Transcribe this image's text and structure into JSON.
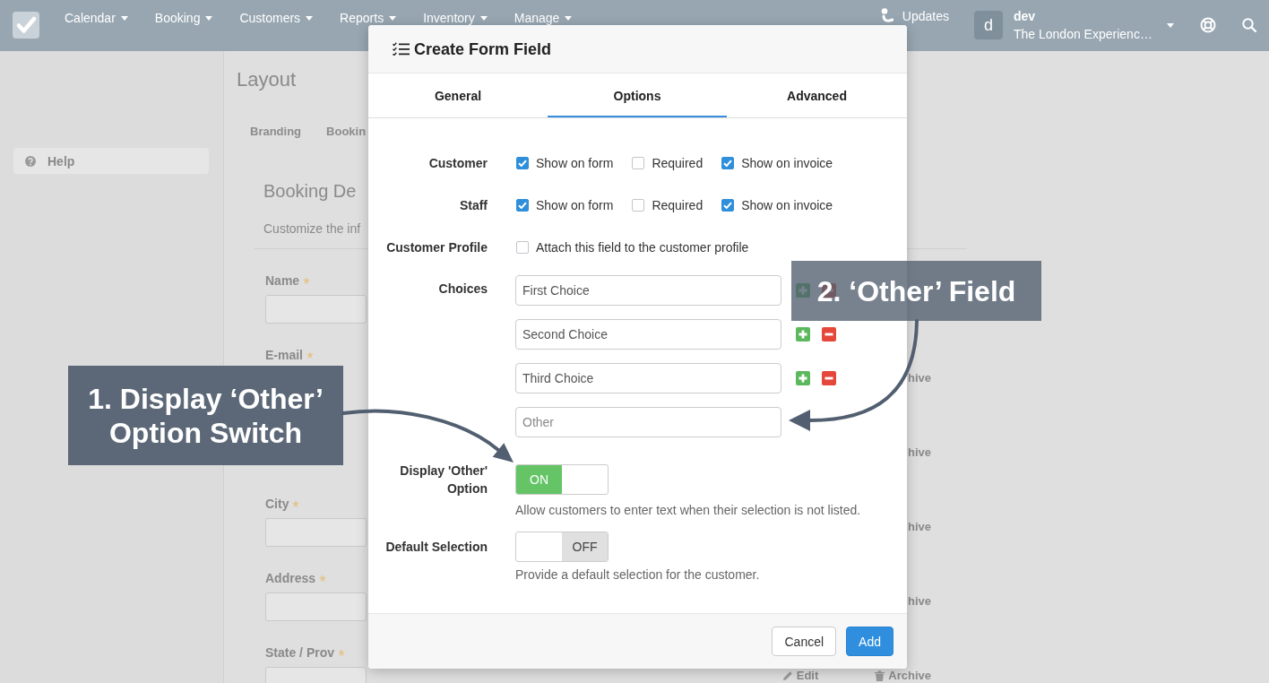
{
  "top_nav": {
    "menus": [
      {
        "label": "Calendar"
      },
      {
        "label": "Booking"
      },
      {
        "label": "Customers"
      },
      {
        "label": "Reports"
      },
      {
        "label": "Inventory"
      },
      {
        "label": "Manage"
      }
    ],
    "updates": "Updates",
    "account": {
      "avatar": "d",
      "name": "dev",
      "organization": "The London Experienc…"
    }
  },
  "sidebar": {
    "items": [
      {
        "label": "Help"
      }
    ]
  },
  "page": {
    "title": "Layout",
    "tabs": [
      {
        "label": "Branding",
        "selected": false
      },
      {
        "label": "Bookin",
        "selected": false
      }
    ],
    "section": {
      "title": "Booking De",
      "description": "Customize the inf",
      "fields": [
        {
          "kind": "input",
          "label": "Name",
          "required": true
        },
        {
          "kind": "label",
          "label": "E-mail",
          "required": true,
          "actions": [
            {
              "kind": "fragment",
              "label": "hive"
            }
          ]
        },
        {
          "kind": "hidden",
          "actions": [
            {
              "kind": "fragment",
              "label": "hive"
            }
          ]
        },
        {
          "kind": "input",
          "label": "City",
          "required": true,
          "actions": [
            {
              "kind": "fragment",
              "label": "hive"
            }
          ]
        },
        {
          "kind": "input",
          "label": "Address",
          "required": true,
          "actions": [
            {
              "kind": "fragment",
              "label": "hive"
            }
          ]
        },
        {
          "kind": "input",
          "label": "State / Prov",
          "required": true,
          "actions": [
            {
              "kind": "edit",
              "label": "Edit"
            },
            {
              "kind": "archive",
              "label": "Archive"
            }
          ]
        }
      ]
    }
  },
  "dialog": {
    "title": "Create Form Field",
    "tabs": [
      {
        "label": "General",
        "selected": false
      },
      {
        "label": "Options",
        "selected": true
      },
      {
        "label": "Advanced",
        "selected": false
      }
    ],
    "rows": [
      {
        "label": "Customer",
        "options": [
          {
            "label": "Show on form",
            "checked": true
          },
          {
            "label": "Required",
            "checked": false
          },
          {
            "label": "Show on invoice",
            "checked": true
          }
        ]
      },
      {
        "label": "Staff",
        "options": [
          {
            "label": "Show on form",
            "checked": true
          },
          {
            "label": "Required",
            "checked": false
          },
          {
            "label": "Show on invoice",
            "checked": true
          }
        ]
      },
      {
        "label": "Customer Profile",
        "options": [
          {
            "label": "Attach this field to the customer profile",
            "checked": false
          }
        ]
      }
    ],
    "choices": {
      "label": "Choices",
      "items": [
        {
          "kind": "choice",
          "value": "First Choice"
        },
        {
          "kind": "choice",
          "value": "Second Choice"
        },
        {
          "kind": "choice",
          "value": "Third Choice"
        },
        {
          "kind": "other",
          "placeholder": "Other"
        }
      ]
    },
    "switches": [
      {
        "label": "Display 'Other' Option",
        "on": true,
        "state": "ON",
        "help": "Allow customers to enter text when their selection is not listed."
      },
      {
        "label": "Default Selection",
        "on": false,
        "state": "OFF",
        "help": "Provide a default selection for the customer."
      }
    ],
    "buttons": [
      {
        "kind": "secondary",
        "label": "Cancel"
      },
      {
        "kind": "primary",
        "label": "Add"
      }
    ]
  },
  "callouts": [
    {
      "text": "1. Display ‘Other’ Option Switch"
    },
    {
      "text": "2. ‘Other’ Field"
    }
  ]
}
